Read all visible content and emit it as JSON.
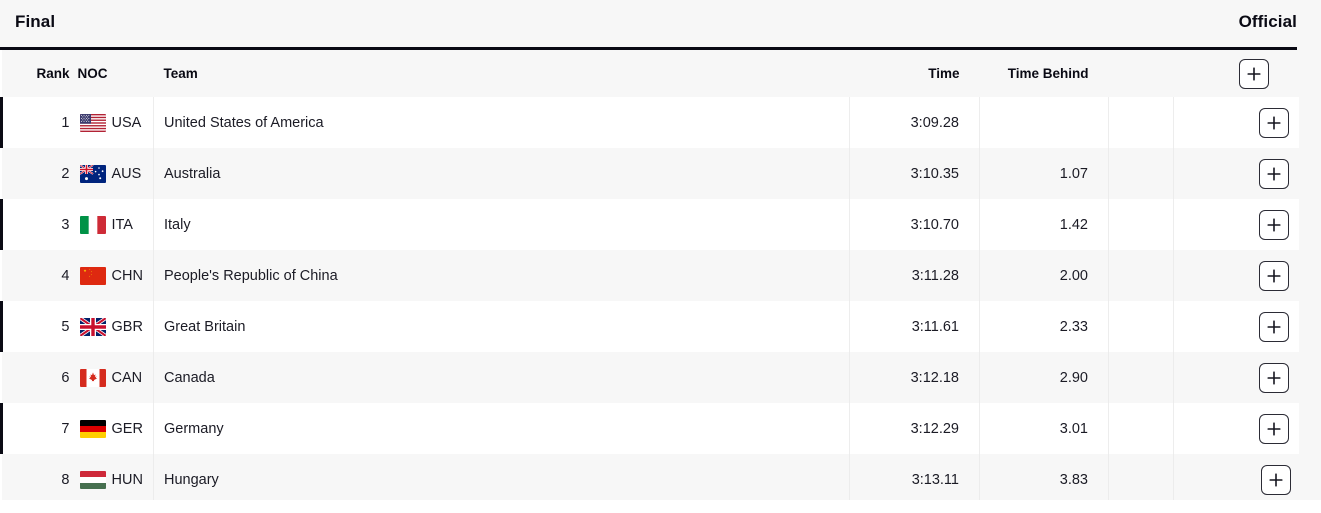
{
  "header": {
    "title": "Final",
    "status": "Official"
  },
  "table": {
    "columns": {
      "rank": "Rank",
      "noc": "NOC",
      "team": "Team",
      "time": "Time",
      "time_behind": "Time Behind",
      "extra_1": "",
      "extra_2": ""
    },
    "expand_button_label": "+",
    "rows": [
      {
        "rank": "1",
        "noc": "USA",
        "flag": "flag-usa",
        "team": "United States of America",
        "time": "3:09.28",
        "time_behind": ""
      },
      {
        "rank": "2",
        "noc": "AUS",
        "flag": "flag-aus",
        "team": "Australia",
        "time": "3:10.35",
        "time_behind": "1.07"
      },
      {
        "rank": "3",
        "noc": "ITA",
        "flag": "flag-ita",
        "team": "Italy",
        "time": "3:10.70",
        "time_behind": "1.42"
      },
      {
        "rank": "4",
        "noc": "CHN",
        "flag": "flag-chn",
        "team": "People's Republic of China",
        "time": "3:11.28",
        "time_behind": "2.00"
      },
      {
        "rank": "5",
        "noc": "GBR",
        "flag": "flag-gbr",
        "team": "Great Britain",
        "time": "3:11.61",
        "time_behind": "2.33"
      },
      {
        "rank": "6",
        "noc": "CAN",
        "flag": "flag-can",
        "team": "Canada",
        "time": "3:12.18",
        "time_behind": "2.90"
      },
      {
        "rank": "7",
        "noc": "GER",
        "flag": "flag-ger",
        "team": "Germany",
        "time": "3:12.29",
        "time_behind": "3.01"
      },
      {
        "rank": "8",
        "noc": "HUN",
        "flag": "flag-hun",
        "team": "Hungary",
        "time": "3:13.11",
        "time_behind": "3.83"
      }
    ]
  },
  "colors": {
    "page_background": "#f7f7f7",
    "row_white": "#ffffff",
    "row_gray": "#f7f7f7",
    "text": "#1b1b25",
    "accent_rule": "#0a0a14"
  }
}
